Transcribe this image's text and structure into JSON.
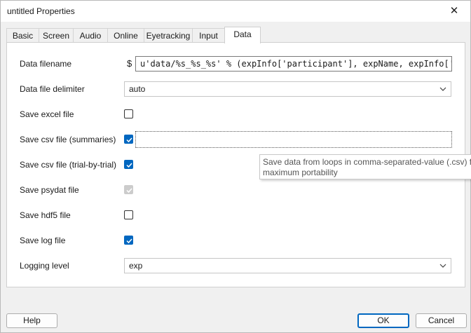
{
  "window": {
    "title": "untitled Properties",
    "close_glyph": "✕"
  },
  "tabs": [
    "Basic",
    "Screen",
    "Audio",
    "Online",
    "Eyetracking",
    "Input",
    "Data"
  ],
  "active_tab": "Data",
  "fields": {
    "data_filename": {
      "label": "Data filename",
      "code_prefix": "$",
      "value": "u'data/%s_%s_%s' % (expInfo['participant'], expName, expInfo['da"
    },
    "delimiter": {
      "label": "Data file delimiter",
      "value": "auto"
    },
    "save_excel": {
      "label": "Save excel file",
      "checked": false
    },
    "save_csv_summaries": {
      "label": "Save csv file (summaries)",
      "checked": true
    },
    "save_csv_trial": {
      "label": "Save csv file (trial-by-trial)",
      "checked": true
    },
    "save_psydat": {
      "label": "Save psydat file",
      "checked": true,
      "disabled": true
    },
    "save_hdf5": {
      "label": "Save hdf5 file",
      "checked": false
    },
    "save_log": {
      "label": "Save log file",
      "checked": true
    },
    "logging_level": {
      "label": "Logging level",
      "value": "exp"
    }
  },
  "tooltip": {
    "line1": "Save data from loops in comma-separated-value (.csv) fo",
    "line2": "maximum portability"
  },
  "buttons": {
    "help": "Help",
    "ok": "OK",
    "cancel": "Cancel"
  },
  "colors": {
    "accent": "#0067c0",
    "window_bg": "#f0f0f0"
  }
}
